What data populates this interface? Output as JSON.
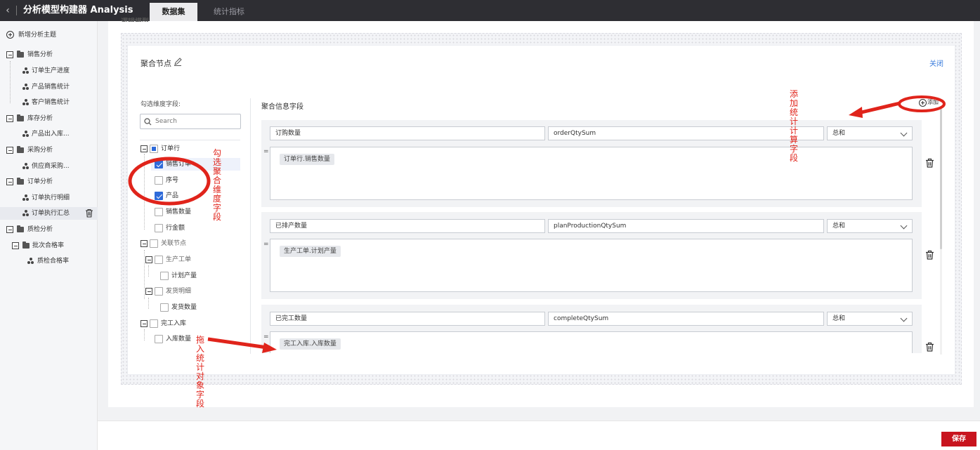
{
  "header": {
    "title": "分析模型构建器 Analysis",
    "tabs": [
      {
        "label": "数据集",
        "active": true
      },
      {
        "label": "统计指标",
        "active": false
      }
    ]
  },
  "sidebar": {
    "add_topic": "新增分析主题",
    "groups": [
      {
        "label": "销售分析",
        "items": [
          "订单生产进度",
          "产品销售统计",
          "客户销售统计"
        ]
      },
      {
        "label": "库存分析",
        "items": [
          "产品出入库..."
        ]
      },
      {
        "label": "采购分析",
        "items": [
          "供应商采购..."
        ]
      },
      {
        "label": "订单分析",
        "items": [
          "订单执行明细",
          "订单执行汇总"
        ],
        "selected": "订单执行汇总"
      },
      {
        "label": "质检分析",
        "subgroups": [
          {
            "label": "批次合格率",
            "items": [
              "质检合格率"
            ]
          }
        ]
      }
    ]
  },
  "main": {
    "section_heading": "逻辑模型",
    "agg_title": "聚合节点",
    "close_label": "关闭",
    "dimension_label": "勾选维度字段:",
    "search": {
      "placeholder": "Search",
      "value": ""
    },
    "tree": [
      {
        "label": "订单行",
        "state": "partial",
        "children": [
          {
            "label": "销售订单",
            "checked": true
          },
          {
            "label": "序号",
            "checked": false
          },
          {
            "label": "产品",
            "checked": true
          },
          {
            "label": "销售数量",
            "checked": false
          },
          {
            "label": "行金额",
            "checked": false
          }
        ]
      },
      {
        "label": "关联节点",
        "state": "unchecked",
        "children": [
          {
            "label": "生产工单",
            "children": [
              {
                "label": "计划产量",
                "checked": false
              }
            ]
          },
          {
            "label": "发货明细",
            "children": [
              {
                "label": "发货数量",
                "checked": false
              }
            ]
          }
        ]
      },
      {
        "label": "完工入库",
        "state": "unchecked",
        "children": [
          {
            "label": "入库数量",
            "checked": false
          }
        ]
      }
    ],
    "info_label": "聚合信息字段",
    "add_label": "添加",
    "aggregations": [
      {
        "name": "订购数量",
        "key": "orderQtySum",
        "func": "总和",
        "eq": "=",
        "chip": "订单行.销售数量"
      },
      {
        "name": "已排产数量",
        "key": "planProductionQtySum",
        "func": "总和",
        "eq": "=",
        "chip": "生产工单.计划产量"
      },
      {
        "name": "已完工数量",
        "key": "completeQtySum",
        "func": "总和",
        "eq": "=",
        "chip": "完工入库.入库数量"
      }
    ]
  },
  "annotations": {
    "add_stat": "添加统计计算字段",
    "check_dims": "勾选聚合维度字段",
    "drag_obj": "拖入统计对象字段"
  },
  "footer": {
    "save_label": "保存"
  },
  "colors": {
    "accent": "#2f6bd9",
    "save": "#c8141e",
    "annotation": "#e0241b",
    "topbar": "#2e2e33"
  }
}
